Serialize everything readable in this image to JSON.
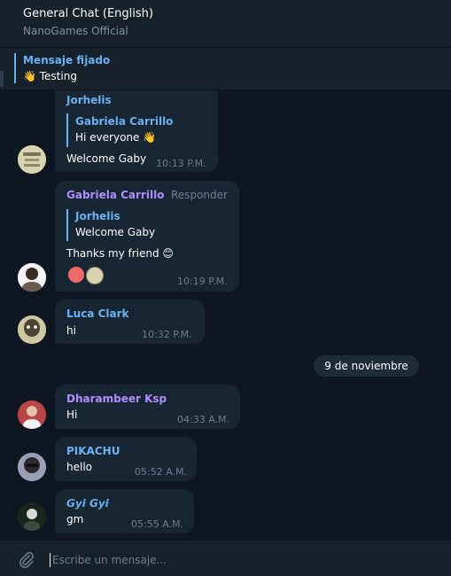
{
  "header": {
    "title": "General Chat (English)",
    "subtitle": "NanoGames Official"
  },
  "pinned": {
    "label": "Mensaje fijado",
    "text": "👋 Testing"
  },
  "messages": [
    {
      "sender": "Jorhelis",
      "reply_name": "Gabriela Carrillo",
      "reply_text": "Hi everyone 👋",
      "text": "Welcome Gaby",
      "time": "10:13 P.M."
    },
    {
      "sender": "Gabriela Carrillo",
      "action": "Responder",
      "reply_name": "Jorhelis",
      "reply_text": "Welcome Gaby",
      "text": "Thanks my friend 😊",
      "time": "10:19 P.M."
    },
    {
      "sender": "Luca Clark",
      "text": "hi",
      "time": "10:32 P.M."
    },
    {
      "sender": "Dharambeer Ksp",
      "text": "Hi",
      "time": "04:33 A.M."
    },
    {
      "sender": "PIKACHU",
      "text": "hello",
      "time": "05:52 A.M."
    },
    {
      "sender": "𝙂𝙮𝙞 𝙂𝙮𝙞",
      "text": "gm",
      "time": "05:55 A.M."
    }
  ],
  "date_separator": "9 de noviembre",
  "composer": {
    "placeholder": "Escribe un mensaje..."
  },
  "colors": {
    "background": "#0e1621",
    "panel": "#17212b",
    "bubble": "#182533",
    "accent_blue": "#6ab2f2",
    "accent_purple": "#b28dff",
    "muted": "#6d7f8f"
  }
}
